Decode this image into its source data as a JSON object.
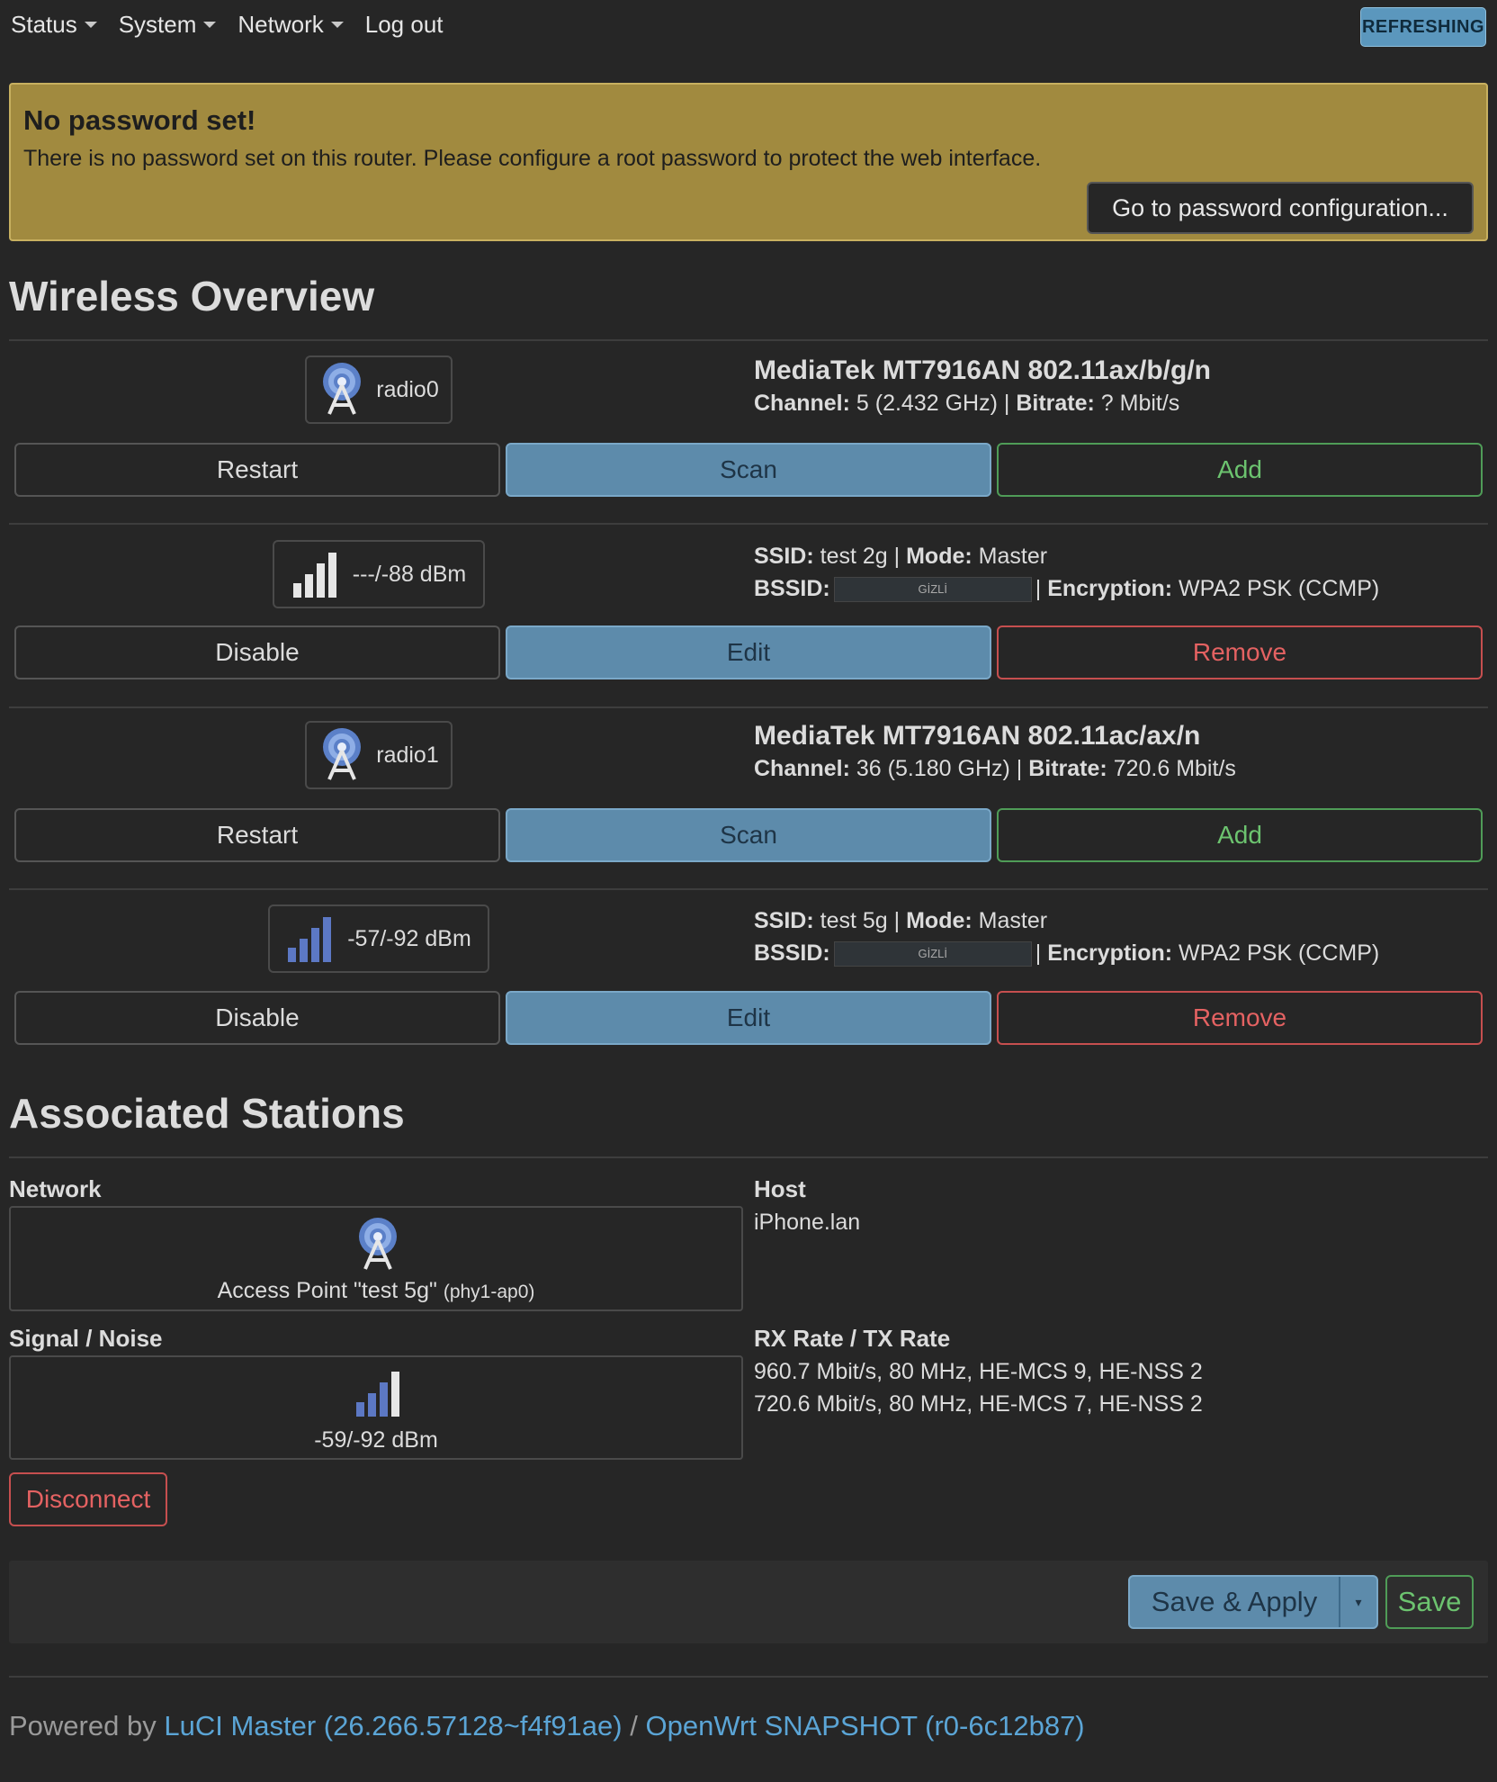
{
  "menu": {
    "items": [
      "Status",
      "System",
      "Network"
    ],
    "logout": "Log out",
    "refreshing": "REFRESHING"
  },
  "alert": {
    "title": "No password set!",
    "text": "There is no password set on this router. Please configure a root password to protect the web interface.",
    "button": "Go to password configuration..."
  },
  "wireless": {
    "title": "Wireless Overview",
    "radios": [
      {
        "name": "radio0",
        "model": "MediaTek MT7916AN 802.11ax/b/g/n",
        "channel_label": "Channel:",
        "channel": "5 (2.432 GHz)",
        "bitrate_label": "Bitrate:",
        "bitrate": "? Mbit/s",
        "buttons": {
          "restart": "Restart",
          "scan": "Scan",
          "add": "Add"
        },
        "network": {
          "signal": "---/-88 dBm",
          "ssid_label": "SSID:",
          "ssid": "test 2g",
          "mode_label": "Mode:",
          "mode": "Master",
          "bssid_label": "BSSID:",
          "bssid": "GİZLİ",
          "enc_label": "Encryption:",
          "encryption": "WPA2 PSK (CCMP)",
          "buttons": {
            "disable": "Disable",
            "edit": "Edit",
            "remove": "Remove"
          }
        }
      },
      {
        "name": "radio1",
        "model": "MediaTek MT7916AN 802.11ac/ax/n",
        "channel_label": "Channel:",
        "channel": "36 (5.180 GHz)",
        "bitrate_label": "Bitrate:",
        "bitrate": "720.6 Mbit/s",
        "buttons": {
          "restart": "Restart",
          "scan": "Scan",
          "add": "Add"
        },
        "network": {
          "signal": "-57/-92 dBm",
          "ssid_label": "SSID:",
          "ssid": "test 5g",
          "mode_label": "Mode:",
          "mode": "Master",
          "bssid_label": "BSSID:",
          "bssid": "GİZLİ",
          "enc_label": "Encryption:",
          "encryption": "WPA2 PSK (CCMP)",
          "buttons": {
            "disable": "Disable",
            "edit": "Edit",
            "remove": "Remove"
          }
        }
      }
    ]
  },
  "stations": {
    "title": "Associated Stations",
    "network_label": "Network",
    "network_value": "Access Point \"test 5g\"",
    "network_iface": "(phy1-ap0)",
    "host_label": "Host",
    "host_value": "iPhone.lan",
    "signal_label": "Signal / Noise",
    "signal_value": "-59/-92 dBm",
    "rate_label": "RX Rate / TX Rate",
    "rx_rate": "960.7 Mbit/s, 80 MHz, HE-MCS 9, HE-NSS 2",
    "tx_rate": "720.6 Mbit/s, 80 MHz, HE-MCS 7, HE-NSS 2",
    "disconnect": "Disconnect"
  },
  "actions": {
    "save_apply": "Save & Apply",
    "save": "Save"
  },
  "footer": {
    "prefix": "Powered by",
    "luci": "LuCI Master (26.266.57128~f4f91ae)",
    "sep": "/",
    "openwrt": "OpenWrt SNAPSHOT (r0-6c12b87)"
  },
  "colors": {
    "background": "#262626",
    "alert": "#a18a3f",
    "primary": "#5d8bab",
    "success": "#4f9c57",
    "danger": "#c64f4f",
    "link": "#5ba5d6"
  }
}
